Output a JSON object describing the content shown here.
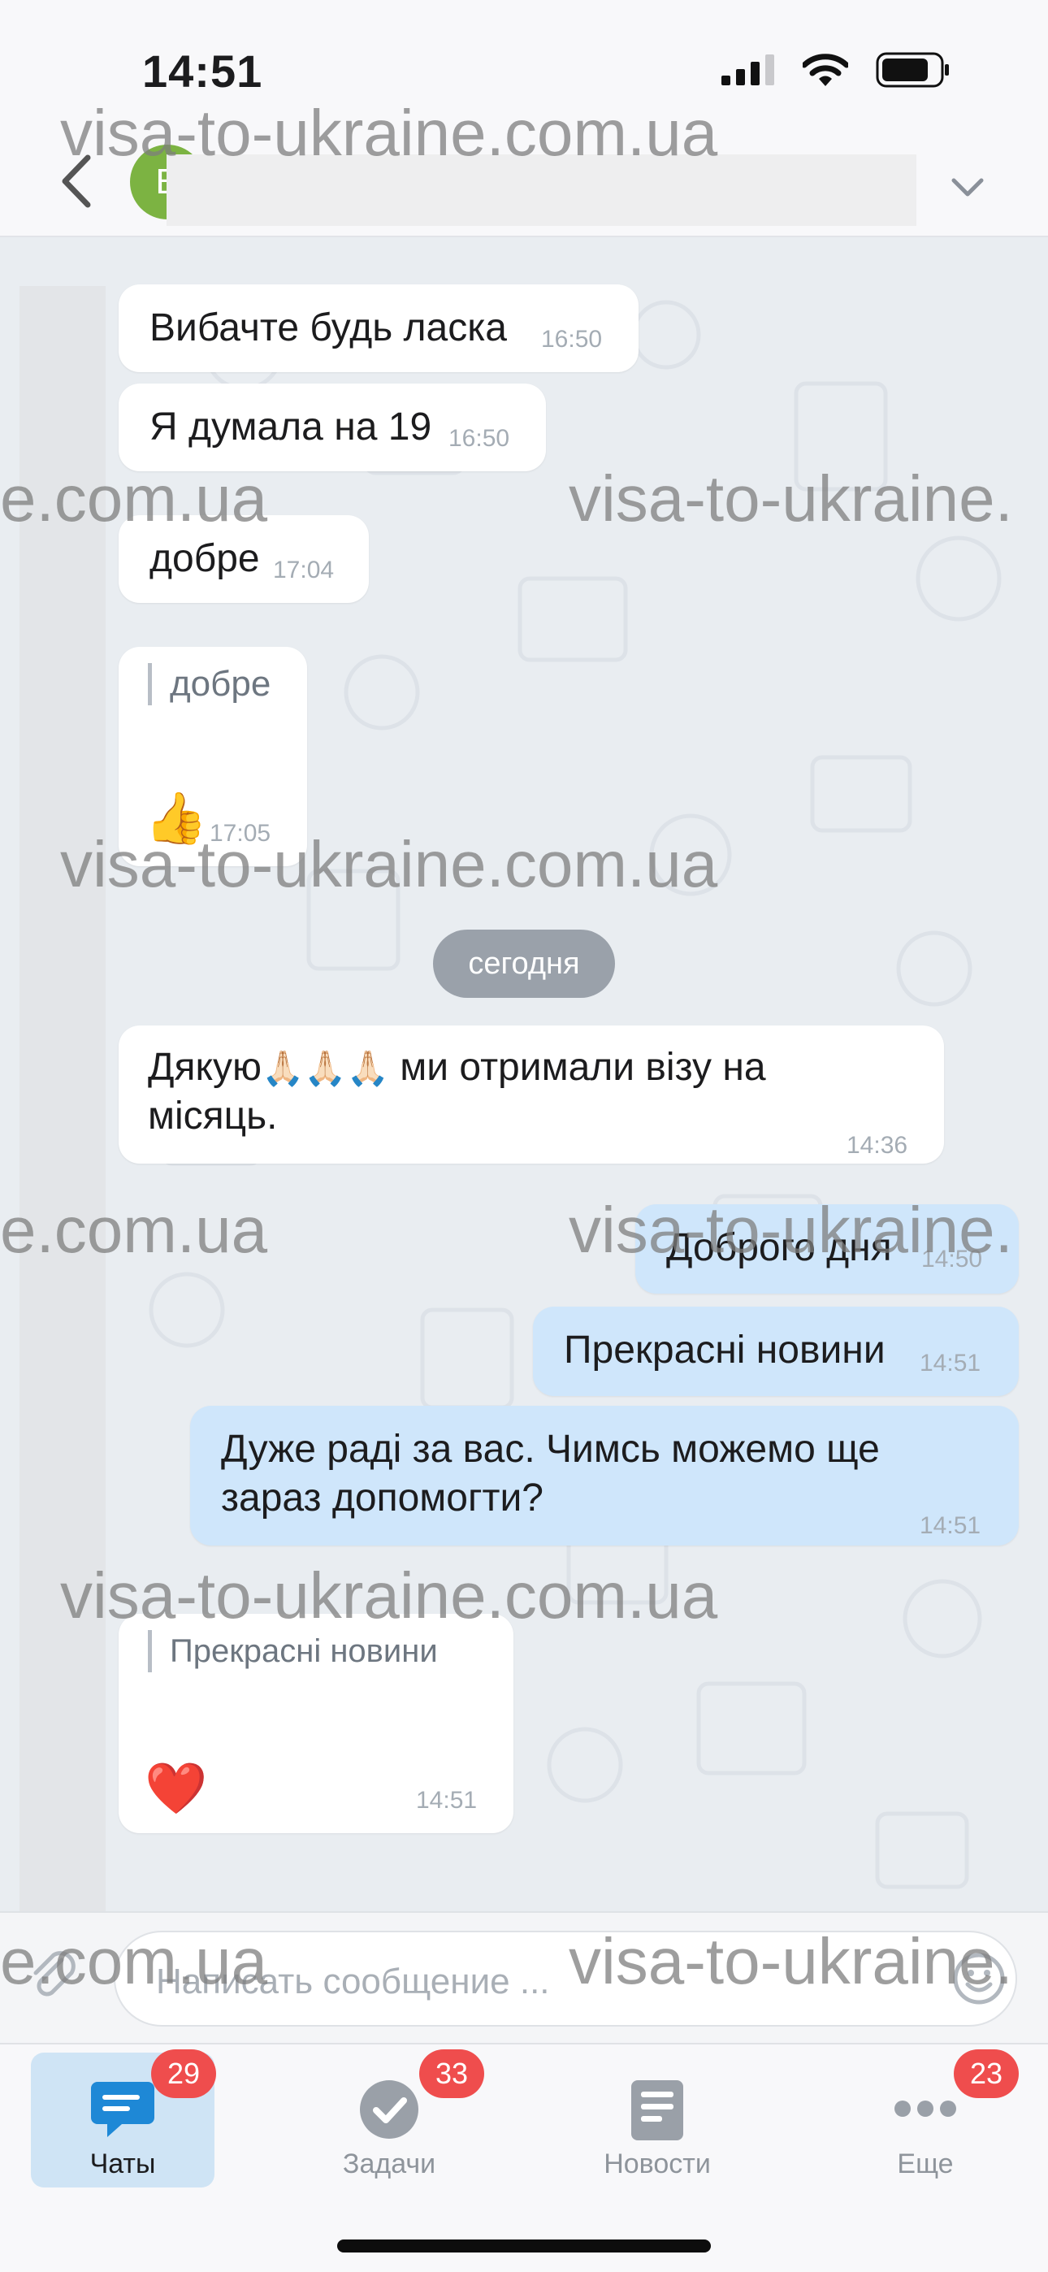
{
  "status_bar": {
    "time": "14:51"
  },
  "header": {
    "avatar_letter": "В",
    "contact_name": ""
  },
  "watermark": {
    "full": "visa-to-ukraine.com.ua",
    "left_part": "e.com.ua",
    "right_part": "visa-to-ukraine."
  },
  "messages": [
    {
      "dir": "in",
      "text": "Вибачте будь ласка",
      "time": "16:50"
    },
    {
      "dir": "in",
      "text": "Я думала на 19",
      "time": "16:50"
    },
    {
      "dir": "in",
      "text": "добре",
      "time": "17:04"
    },
    {
      "dir": "in",
      "quote": "добре",
      "emoji": "👍",
      "time": "17:05"
    },
    {
      "dir": "separator",
      "text": "сегодня"
    },
    {
      "dir": "in",
      "line1_start": "Дякую",
      "line1_emoji": "🙏🏻🙏🏻🙏🏻",
      "line1_end": "ми отримали візу на",
      "line2": "місяць.",
      "time": "14:36"
    },
    {
      "dir": "out",
      "text": "Доброго дня",
      "time": "14:50"
    },
    {
      "dir": "out",
      "text": "Прекрасні новини",
      "time": "14:51"
    },
    {
      "dir": "out",
      "line1": "Дуже раді за вас. Чимсь можемо ще",
      "line2": "зараз допомогти?",
      "time": "14:51"
    },
    {
      "dir": "in",
      "quote": "Прекрасні новини",
      "emoji": "❤️",
      "time": "14:51"
    }
  ],
  "composer": {
    "placeholder": "Написать сообщение ..."
  },
  "tabs": [
    {
      "label": "Чаты",
      "badge": "29",
      "icon": "chat-bubble-icon",
      "active": true
    },
    {
      "label": "Задачи",
      "badge": "33",
      "icon": "check-circle-icon",
      "active": false
    },
    {
      "label": "Новости",
      "badge": "",
      "icon": "newspaper-icon",
      "active": false
    },
    {
      "label": "Еще",
      "badge": "23",
      "icon": "more-dots-icon",
      "active": false
    }
  ],
  "colors": {
    "accent": "#1e88d6",
    "badge": "#ef4d4d",
    "outgoing_bubble": "#cfe6fb",
    "avatar": "#7cb342"
  }
}
